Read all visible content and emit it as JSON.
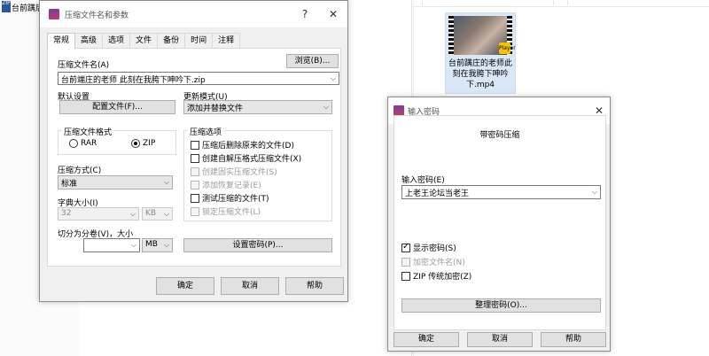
{
  "background": {
    "left_file_label": "台前蹒后",
    "left_file_icon_text": "ZIP",
    "thumbnail": {
      "label": "台前蹒庄的老师此刻在我胯下呻吟下.mp4",
      "badge": "Player"
    }
  },
  "archive_dialog": {
    "title": "压缩文件名和参数",
    "help_glyph": "?",
    "close_glyph": "✕",
    "tabs": [
      "常规",
      "高级",
      "选项",
      "文件",
      "备份",
      "时间",
      "注释"
    ],
    "archive_name_label": "压缩文件名(A)",
    "browse_button": "浏览(B)...",
    "archive_name_value": "台前端庄的老师 此刻在我胯下呻吟下.zip",
    "default_profile_label": "默认设置",
    "profiles_button": "配置文件(F)...",
    "update_mode_label": "更新模式(U)",
    "update_mode_value": "添加并替换文件",
    "format_group_label": "压缩文件格式",
    "format_rar": "RAR",
    "format_zip": "ZIP",
    "options_group_label": "压缩选项",
    "options": [
      {
        "label": "压缩后删除原来的文件(D)",
        "checked": false,
        "disabled": false
      },
      {
        "label": "创建自解压格式压缩文件(X)",
        "checked": false,
        "disabled": false
      },
      {
        "label": "创建固实压缩文件(S)",
        "checked": false,
        "disabled": true
      },
      {
        "label": "添加恢复记录(E)",
        "checked": false,
        "disabled": true
      },
      {
        "label": "测试压缩的文件(T)",
        "checked": false,
        "disabled": false
      },
      {
        "label": "锁定压缩文件(L)",
        "checked": false,
        "disabled": true
      }
    ],
    "method_label": "压缩方式(C)",
    "method_value": "标准",
    "dict_label": "字典大小(I)",
    "dict_value": "32",
    "dict_unit": "KB",
    "split_label": "切分为分卷(V)，大小",
    "split_value": "",
    "split_unit": "MB",
    "set_password_button": "设置密码(P)...",
    "ok_button": "确定",
    "cancel_button": "取消",
    "help_button": "帮助"
  },
  "password_dialog": {
    "title": "输入密码",
    "close_glyph": "✕",
    "heading": "带密码压缩",
    "password_label": "输入密码(E)",
    "password_value": "上老王论坛当老王",
    "show_password": {
      "label": "显示密码(S)",
      "checked": true
    },
    "encrypt_names": {
      "label": "加密文件名(N)",
      "checked": false,
      "disabled": true
    },
    "zip_legacy": {
      "label": "ZIP 传统加密(Z)",
      "checked": false
    },
    "organize_button": "整理密码(O)...",
    "ok_button": "确定",
    "cancel_button": "取消",
    "help_button": "帮助"
  }
}
